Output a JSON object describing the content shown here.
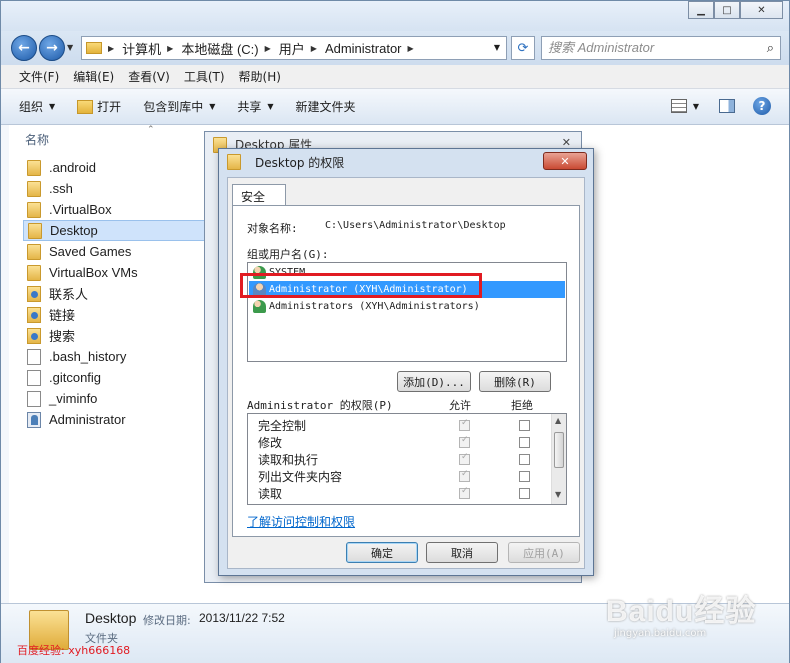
{
  "explorer": {
    "nav": {
      "back_icon": "back-arrow-icon",
      "forward_icon": "forward-arrow-icon"
    },
    "address": {
      "crumbs": [
        "计算机",
        "本地磁盘 (C:)",
        "用户",
        "Administrator"
      ]
    },
    "search": {
      "placeholder": "搜索 Administrator"
    },
    "menu": [
      "文件(F)",
      "编辑(E)",
      "查看(V)",
      "工具(T)",
      "帮助(H)"
    ],
    "toolbar": {
      "organize": "组织",
      "open": "打开",
      "include_in_library": "包含到库中",
      "share": "共享",
      "new_folder": "新建文件夹"
    },
    "filelist": {
      "column_name": "名称",
      "items": [
        {
          "name": ".android",
          "icon": "folder-icon"
        },
        {
          "name": ".ssh",
          "icon": "folder-icon"
        },
        {
          "name": ".VirtualBox",
          "icon": "folder-icon"
        },
        {
          "name": "Desktop",
          "icon": "folder-icon",
          "selected": true
        },
        {
          "name": "Saved Games",
          "icon": "folder-icon"
        },
        {
          "name": "VirtualBox VMs",
          "icon": "folder-icon"
        },
        {
          "name": "联系人",
          "icon": "contacts-folder-icon"
        },
        {
          "name": "链接",
          "icon": "links-folder-icon"
        },
        {
          "name": "搜索",
          "icon": "searches-folder-icon"
        },
        {
          "name": ".bash_history",
          "icon": "file-icon"
        },
        {
          "name": ".gitconfig",
          "icon": "file-icon"
        },
        {
          "name": "_viminfo",
          "icon": "file-icon"
        },
        {
          "name": "Administrator",
          "icon": "shortcut-icon"
        }
      ]
    },
    "details": {
      "name": "Desktop",
      "modified_label": "修改日期:",
      "modified_value": "2013/11/22 7:52",
      "type": "文件夹"
    }
  },
  "props_window": {
    "title": "Desktop 属性"
  },
  "perm_dialog": {
    "title": "Desktop 的权限",
    "tab": "安全",
    "object_label": "对象名称:",
    "object_value": "C:\\Users\\Administrator\\Desktop",
    "group_label": "组或用户名(G):",
    "users": [
      {
        "name": "SYSTEM",
        "icon": "group-user-icon"
      },
      {
        "name": "Administrator (XYH\\Administrator)",
        "icon": "user-icon",
        "selected": true
      },
      {
        "name": "Administrators (XYH\\Administrators)",
        "icon": "group-user-icon"
      }
    ],
    "add_button": "添加(D)...",
    "remove_button": "删除(R)",
    "permissions_header": "Administrator 的权限(P)",
    "allow_header": "允许",
    "deny_header": "拒绝",
    "permissions": [
      {
        "name": "完全控制",
        "allow": true,
        "deny": false
      },
      {
        "name": "修改",
        "allow": true,
        "deny": false
      },
      {
        "name": "读取和执行",
        "allow": true,
        "deny": false
      },
      {
        "name": "列出文件夹内容",
        "allow": true,
        "deny": false
      },
      {
        "name": "读取",
        "allow": true,
        "deny": false
      }
    ],
    "link": "了解访问控制和权限",
    "ok": "确定",
    "cancel": "取消",
    "apply": "应用(A)"
  },
  "watermark": {
    "left": "百度经验: xyh666168",
    "right": "Baidu经验",
    "right_sub": "jingyan.baidu.com"
  }
}
